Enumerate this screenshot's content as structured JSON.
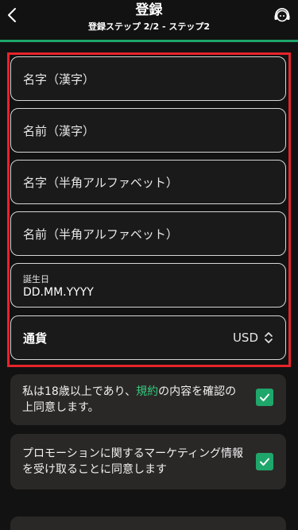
{
  "header": {
    "title": "登録",
    "subtitle": "登録ステップ 2/2 - ステップ2"
  },
  "form": {
    "last_name_kanji": {
      "placeholder": "名字（漢字）"
    },
    "first_name_kanji": {
      "placeholder": "名前（漢字）"
    },
    "last_name_alpha": {
      "placeholder": "名字（半角アルファベット）"
    },
    "first_name_alpha": {
      "placeholder": "名前（半角アルファベット）"
    },
    "birthdate": {
      "label": "誕生日",
      "value": "DD.MM.YYYY"
    },
    "currency": {
      "label": "通貨",
      "value": "USD"
    }
  },
  "consents": {
    "age_terms": {
      "text_before": "私は18歳以上であり、",
      "link": "規約",
      "text_after": "の内容を確認の上同意します。",
      "checked": true
    },
    "marketing": {
      "text": "プロモーションに関するマーケティング情報を受け取ることに同意します",
      "checked": true
    }
  },
  "colors": {
    "accent": "#1fa66b",
    "link": "#34c97f",
    "highlight_border": "#e8242c",
    "background": "#121212",
    "card": "#2a2826"
  },
  "icons": {
    "back": "chevron-left",
    "support": "headset",
    "currency_arrows": "chevron-up-down",
    "check": "checkmark"
  }
}
